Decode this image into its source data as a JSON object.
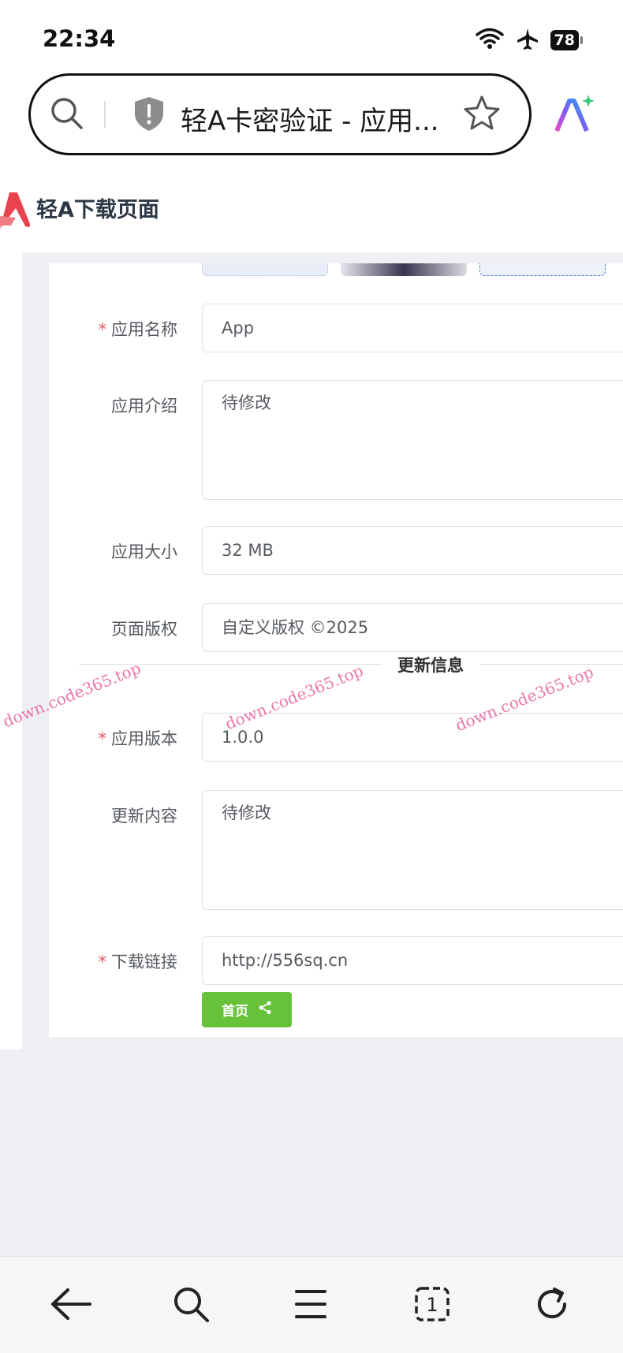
{
  "status_bar": {
    "time": "22:34",
    "battery": "78"
  },
  "browser": {
    "tab_title": "轻A卡密验证 - 应用..."
  },
  "site": {
    "title": "轻A下载页面"
  },
  "form": {
    "app_name": {
      "label": "应用名称",
      "required_mark": "*",
      "value": "App"
    },
    "app_intro": {
      "label": "应用介绍",
      "value": "待修改"
    },
    "app_size": {
      "label": "应用大小",
      "value": "32 MB"
    },
    "copyright": {
      "label": "页面版权",
      "value": "自定义版权 ©2025"
    },
    "section_divider": "更新信息",
    "app_version": {
      "label": "应用版本",
      "required_mark": "*",
      "value": "1.0.0"
    },
    "update_content": {
      "label": "更新内容",
      "value": "待修改"
    },
    "download_link": {
      "label": "下载链接",
      "required_mark": "*",
      "value": "http://556sq.cn"
    },
    "home_button": "首页"
  },
  "watermarks": [
    "down.code365.top",
    "down.code365.top",
    "down.code365.top"
  ],
  "colors": {
    "accent_green": "#67c23a",
    "required_red": "#e4565a",
    "page_bg": "#eff0f4",
    "watermark": "#e8609a"
  },
  "bottom_nav": {
    "tab_count": "1"
  }
}
